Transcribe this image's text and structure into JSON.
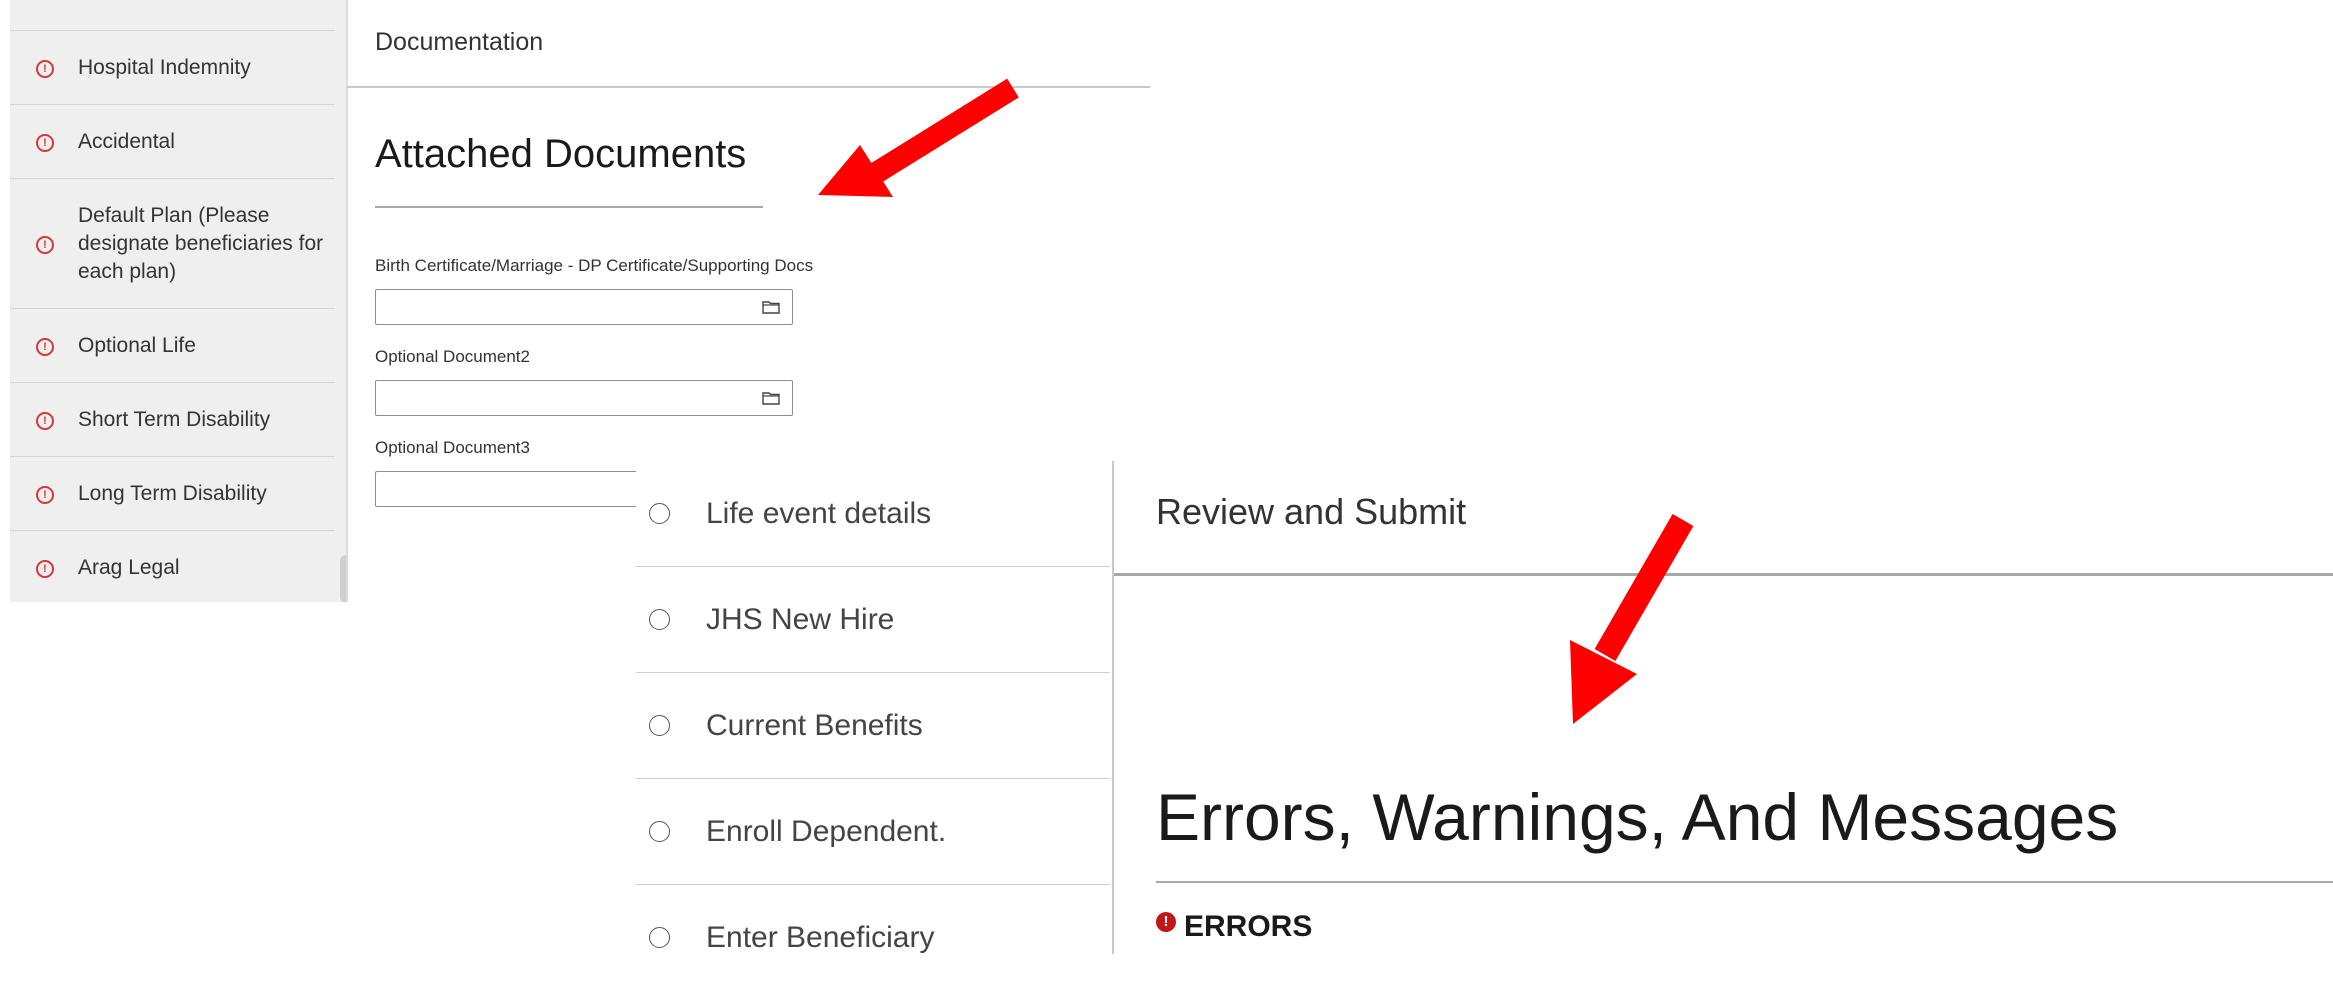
{
  "documentation_panel": {
    "sidebar_items": [
      {
        "label": "Hospital Indemnity",
        "status_icon": "warning-circle-icon"
      },
      {
        "label": "Accidental",
        "status_icon": "warning-circle-icon"
      },
      {
        "label": "Default Plan (Please designate beneficiaries for each plan)",
        "status_icon": "warning-circle-icon"
      },
      {
        "label": "Optional Life",
        "status_icon": "warning-circle-icon"
      },
      {
        "label": "Short Term Disability",
        "status_icon": "warning-circle-icon"
      },
      {
        "label": "Long Term Disability",
        "status_icon": "warning-circle-icon"
      },
      {
        "label": "Arag Legal",
        "status_icon": "warning-circle-icon"
      }
    ],
    "header": "Documentation",
    "section_title": "Attached Documents",
    "fields": [
      {
        "label": "Birth Certificate/Marriage - DP Certificate/Supporting Docs",
        "value": "",
        "icon": "folder-icon"
      },
      {
        "label": "Optional Document2",
        "value": "",
        "icon": "folder-icon"
      },
      {
        "label": "Optional Document3",
        "value": "",
        "icon": "folder-icon"
      }
    ]
  },
  "review_panel": {
    "steps": [
      {
        "label": "Life event details"
      },
      {
        "label": "JHS New Hire"
      },
      {
        "label": "Current Benefits"
      },
      {
        "label": "Enroll Dependent."
      },
      {
        "label": "Enter Beneficiary"
      }
    ],
    "header": "Review and Submit",
    "section_title": "Errors, Warnings, And Messages",
    "errors_label": "ERRORS",
    "errors_icon": "error-exclamation-icon"
  },
  "colors": {
    "warning": "#d23a3a",
    "error": "#c01818",
    "arrow": "#ff0000",
    "sidebar_bg": "#efefef"
  }
}
